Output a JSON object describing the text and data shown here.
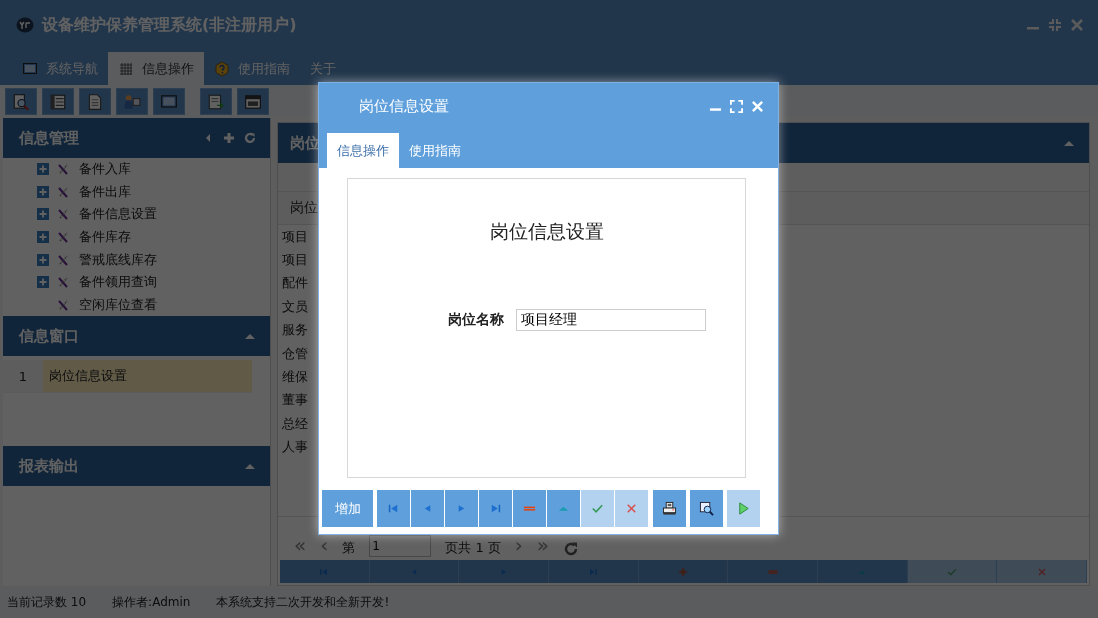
{
  "window": {
    "title": "设备维护保养管理系统(非注册用户)"
  },
  "tabs": [
    {
      "label": "系统导航",
      "kind": "monitor",
      "selected": false
    },
    {
      "label": "信息操作",
      "kind": "grid",
      "selected": true
    },
    {
      "label": "使用指南",
      "kind": "help",
      "selected": false
    },
    {
      "label": "关于",
      "kind": "plain",
      "selected": false
    }
  ],
  "toolbar": [
    {
      "kind": "search"
    },
    {
      "kind": "list"
    },
    {
      "kind": "document"
    },
    {
      "kind": "user"
    },
    {
      "kind": "monitor"
    },
    {
      "kind": "export"
    },
    {
      "kind": "window"
    }
  ],
  "sidebar": {
    "panels": [
      {
        "title": "信息管理",
        "kind": "tree",
        "items": [
          {
            "label": "备件入库",
            "expandable": true
          },
          {
            "label": "备件出库",
            "expandable": true
          },
          {
            "label": "备件信息设置",
            "expandable": true
          },
          {
            "label": "备件库存",
            "expandable": true
          },
          {
            "label": "警戒底线库存",
            "expandable": true
          },
          {
            "label": "备件领用查询",
            "expandable": true
          },
          {
            "label": "空闲库位查看",
            "expandable": false
          }
        ]
      },
      {
        "title": "信息窗口",
        "kind": "list",
        "rows": [
          {
            "index": "1",
            "label": "岗位信息设置",
            "selected": true
          }
        ]
      },
      {
        "title": "报表输出",
        "kind": "empty"
      }
    ]
  },
  "main": {
    "title": "岗位",
    "columns": [
      "岗位"
    ],
    "rows": [
      "项目",
      "项目",
      "配件",
      "文员",
      "服务",
      "仓管",
      "维保",
      "董事",
      "总经",
      "人事"
    ],
    "pager": {
      "first": "«",
      "prev": "‹",
      "page_label": "第",
      "page": "1",
      "total": "页共 1 页",
      "next": "›",
      "last": "»"
    },
    "nav_bar": [
      {
        "kind": "first",
        "disabled": false
      },
      {
        "kind": "prev",
        "disabled": false
      },
      {
        "kind": "next",
        "disabled": false
      },
      {
        "kind": "last",
        "disabled": false
      },
      {
        "kind": "add",
        "disabled": false
      },
      {
        "kind": "delete",
        "disabled": false
      },
      {
        "kind": "up",
        "disabled": false
      },
      {
        "kind": "check",
        "disabled": true
      },
      {
        "kind": "cancel",
        "disabled": true
      }
    ]
  },
  "status_bar": [
    "当前记录数 10",
    "操作者:Admin",
    "本系统支持二次开发和全新开发!"
  ],
  "dialog": {
    "title": "岗位信息设置",
    "tabs": [
      {
        "label": "信息操作",
        "selected": true
      },
      {
        "label": "使用指南",
        "selected": false
      }
    ],
    "heading": "岗位信息设置",
    "fields": [
      {
        "label": "岗位名称",
        "value": "项目经理"
      }
    ],
    "button_groups": [
      [
        {
          "kind": "text",
          "label": "增加",
          "disabled": false
        }
      ],
      [
        {
          "kind": "first",
          "disabled": false
        },
        {
          "kind": "prev",
          "disabled": false
        },
        {
          "kind": "next",
          "disabled": false
        },
        {
          "kind": "last",
          "disabled": false
        },
        {
          "kind": "delete",
          "disabled": false
        },
        {
          "kind": "up",
          "disabled": false
        },
        {
          "kind": "check",
          "disabled": true
        },
        {
          "kind": "cancel",
          "disabled": true
        }
      ],
      [
        {
          "kind": "print",
          "disabled": false
        }
      ],
      [
        {
          "kind": "preview",
          "disabled": false
        }
      ],
      [
        {
          "kind": "run",
          "disabled": true
        }
      ]
    ]
  }
}
